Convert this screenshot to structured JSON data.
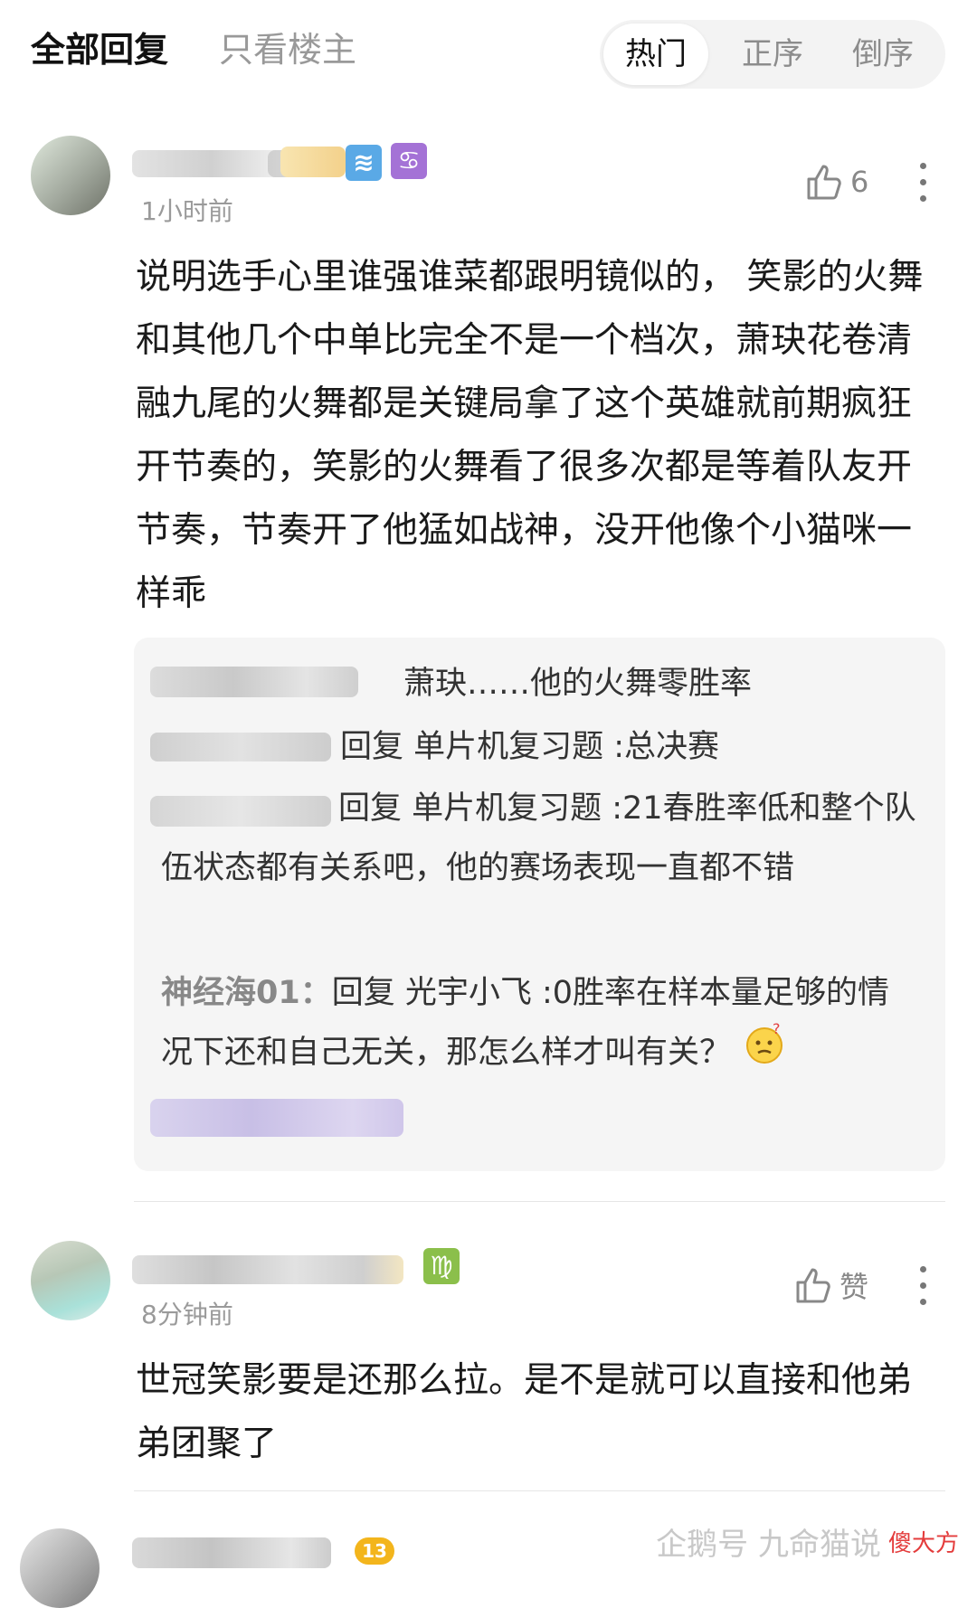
{
  "header": {
    "tab_all": "全部回复",
    "tab_op": "只看楼主",
    "sort": [
      "热门",
      "正序",
      "倒序"
    ]
  },
  "comments": [
    {
      "time": "1小时前",
      "likes": "6",
      "badges": [
        "≋",
        "♋"
      ],
      "content": "说明选手心里谁强谁菜都跟明镜似的， 笑影的火舞和其他几个中单比完全不是一个档次，萧玦花卷清融九尾的火舞都是关键局拿了这个英雄就前期疯狂开节奏的，笑影的火舞看了很多次都是等着队友开节奏，节奏开了他猛如战神，没开他像个小猫咪一样乖",
      "replies": [
        {
          "text": "萧玦……他的火舞零胜率"
        },
        {
          "text": "回复 单片机复习题 :总决赛"
        },
        {
          "text": "回复 单片机复习题 :21春胜率低和整个队伍状态都有关系吧，他的赛场表现一直都不错"
        },
        {
          "name": "神经海01：",
          "text": "回复 光宇小飞 :0胜率在样本量足够的情况下还和自己无关，那怎么样才叫有关？"
        }
      ]
    },
    {
      "time": "8分钟前",
      "likes": "赞",
      "badges": [
        "♍"
      ],
      "content": "世冠笑影要是还那么拉。是不是就可以直接和他弟弟团聚了"
    },
    {
      "level": "13"
    }
  ],
  "watermark": {
    "text": "企鹅号 九命猫说",
    "corner": "傻大方"
  },
  "colors": {
    "aquarius": "#5aa9e6",
    "cancer": "#a472d6",
    "virgo": "#8bbf4b",
    "level": "#f3b51c"
  },
  "icons": {
    "like": "thumbs-up-icon",
    "more": "more-vertical-icon",
    "emoji": "thinking-face-icon"
  }
}
